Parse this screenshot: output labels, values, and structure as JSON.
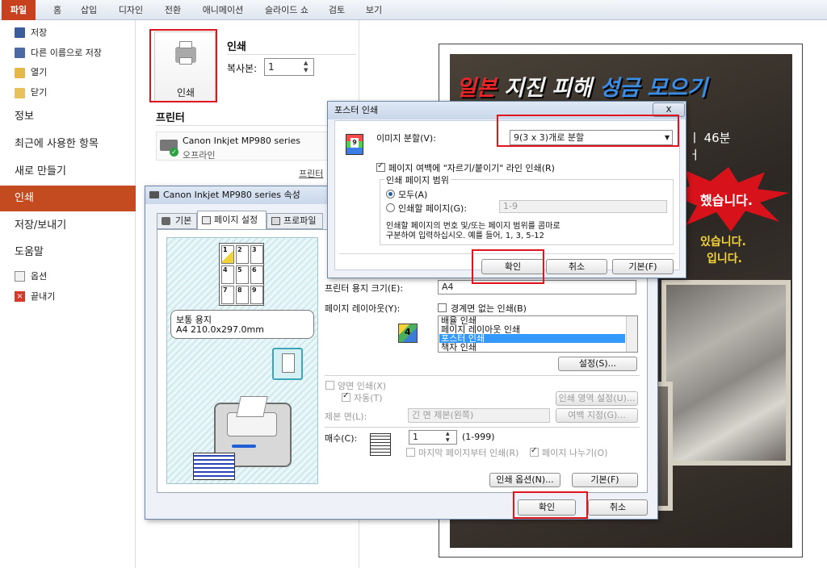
{
  "ribbon": {
    "tabs": [
      "파일",
      "홈",
      "삽입",
      "디자인",
      "전환",
      "애니메이션",
      "슬라이드 쇼",
      "검토",
      "보기"
    ]
  },
  "backstage": {
    "small_items": [
      "저장",
      "다른 이름으로 저장",
      "열기",
      "닫기"
    ],
    "big_items": [
      "정보",
      "최근에 사용한 항목",
      "새로 만들기",
      "인쇄",
      "저장/보내기",
      "도움말"
    ],
    "bottom_items": [
      "옵션",
      "끝내기"
    ],
    "active": "인쇄"
  },
  "print_panel": {
    "print_button_label": "인쇄",
    "section_title": "인쇄",
    "copies_label": "복사본:",
    "copies_value": "1",
    "printer_header": "프린터",
    "printer_name": "Canon Inkjet MP980 series",
    "printer_status": "오프라인",
    "printer_properties_link": "프린터"
  },
  "slide": {
    "title_part1": "일본",
    "title_part2": " 지진 피해 ",
    "title_part3": "성금 모으기",
    "line1": "ㅣ 46분",
    "line2": "ㅓ",
    "burst_text": "했습니다.",
    "line3": "있습니다.",
    "line4": "입니다."
  },
  "props_dialog": {
    "title": "Canon Inkjet MP980 series 속성",
    "tabs": [
      "기본",
      "페이지 설정",
      "프로파일"
    ],
    "preview_paper_name": "보통 용지",
    "preview_paper_size": "A4 210.0x297.0mm",
    "printer_paper_size_label": "프린터 용지 크기(E):",
    "printer_paper_size_value": "A4",
    "layout_label": "페이지 레이아웃(Y):",
    "borderless_label": "경계면 없는 인쇄(B)",
    "layout_options": [
      "배율 인쇄",
      "페이지 레이아웃 인쇄",
      "포스터 인쇄",
      "책자 인쇄"
    ],
    "layout_selected": "포스터 인쇄",
    "settings_button": "설정(S)...",
    "duplex_label": "양면 인쇄(X)",
    "auto_label": "자동(T)",
    "print_area_button": "인쇄 영역 설정(U)...",
    "binding_label": "제본 면(L):",
    "binding_value": "긴 면 제본(왼쪽)",
    "margin_button": "여백 지정(G)...",
    "copies_label": "매수(C):",
    "copies_value": "1",
    "copies_range": "(1-999)",
    "last_page_first_label": "마지막 페이지부터 인쇄(R)",
    "collate_label": "페이지 나누기(O)",
    "print_options_button": "인쇄 옵션(N)...",
    "defaults_button": "기본(F)",
    "ok_button": "확인",
    "cancel_button": "취소"
  },
  "poster_dialog": {
    "title": "포스터 인쇄",
    "split_label": "이미지 분할(V):",
    "split_value": "9(3 x 3)개로 분할",
    "cut_lines_label": "페이지 여백에 \"자르기/붙이기\" 라인 인쇄(R)",
    "range_group": "인쇄 페이지 범위",
    "all_label": "모두(A)",
    "pages_label": "인쇄할 페이지(G):",
    "pages_value": "1-9",
    "help_line1": "인쇄할 페이지의 번호 및/또는 페이지 범위를 콤마로",
    "help_line2": "구분하여 입력하십시오. 예를 들어, 1, 3, 5-12",
    "ok_button": "확인",
    "cancel_button": "취소",
    "defaults_button": "기본(F)",
    "close_button": "x"
  },
  "colors": {
    "file_tab": "#c7411e",
    "active_item": "#c44a20",
    "highlight_red": "#e0141a",
    "selection_blue": "#3399ff"
  }
}
